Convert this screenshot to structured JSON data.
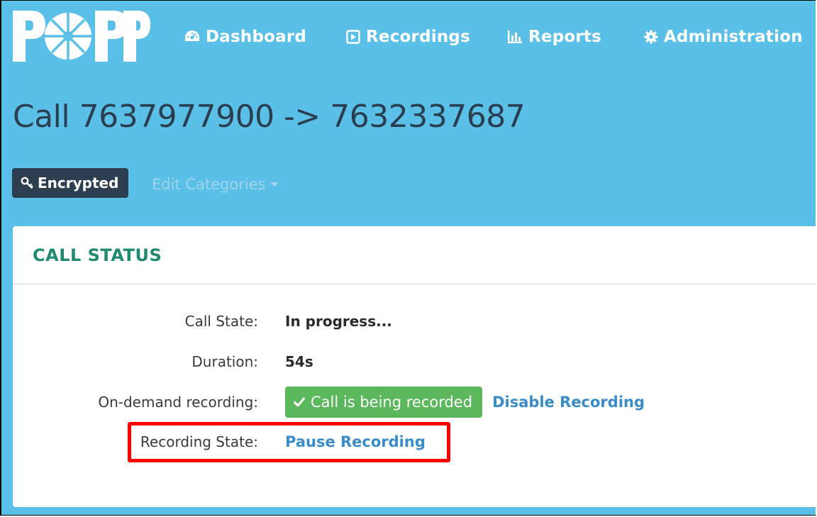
{
  "brand": {
    "logo_text": "POPP"
  },
  "nav": {
    "items": [
      {
        "label": "Dashboard",
        "icon": "dashboard-gauge-icon"
      },
      {
        "label": "Recordings",
        "icon": "play-square-icon"
      },
      {
        "label": "Reports",
        "icon": "bar-chart-icon"
      },
      {
        "label": "Administration",
        "icon": "gear-icon"
      }
    ]
  },
  "page": {
    "title": "Call 7637977900 -> 7632337687",
    "badge": {
      "label": "Encrypted",
      "icon": "key-icon"
    },
    "edit_categories_label": "Edit Categories"
  },
  "call_status": {
    "title": "CALL STATUS",
    "rows": {
      "state": {
        "label": "Call State:",
        "value": "In progress..."
      },
      "duration": {
        "label": "Duration:",
        "value": "54s"
      },
      "ondemand": {
        "label": "On-demand recording:",
        "status": "Call is being recorded",
        "action": "Disable Recording"
      },
      "recording_state": {
        "label": "Recording State:",
        "action": "Pause Recording"
      }
    }
  },
  "colors": {
    "header_bg": "#5bc0e8",
    "title_text": "#2b3e50",
    "badge_bg": "#2d3e50",
    "panel_title": "#1f8a6f",
    "success": "#5cb85c",
    "link": "#3a8cc8",
    "highlight": "#ff0000"
  }
}
